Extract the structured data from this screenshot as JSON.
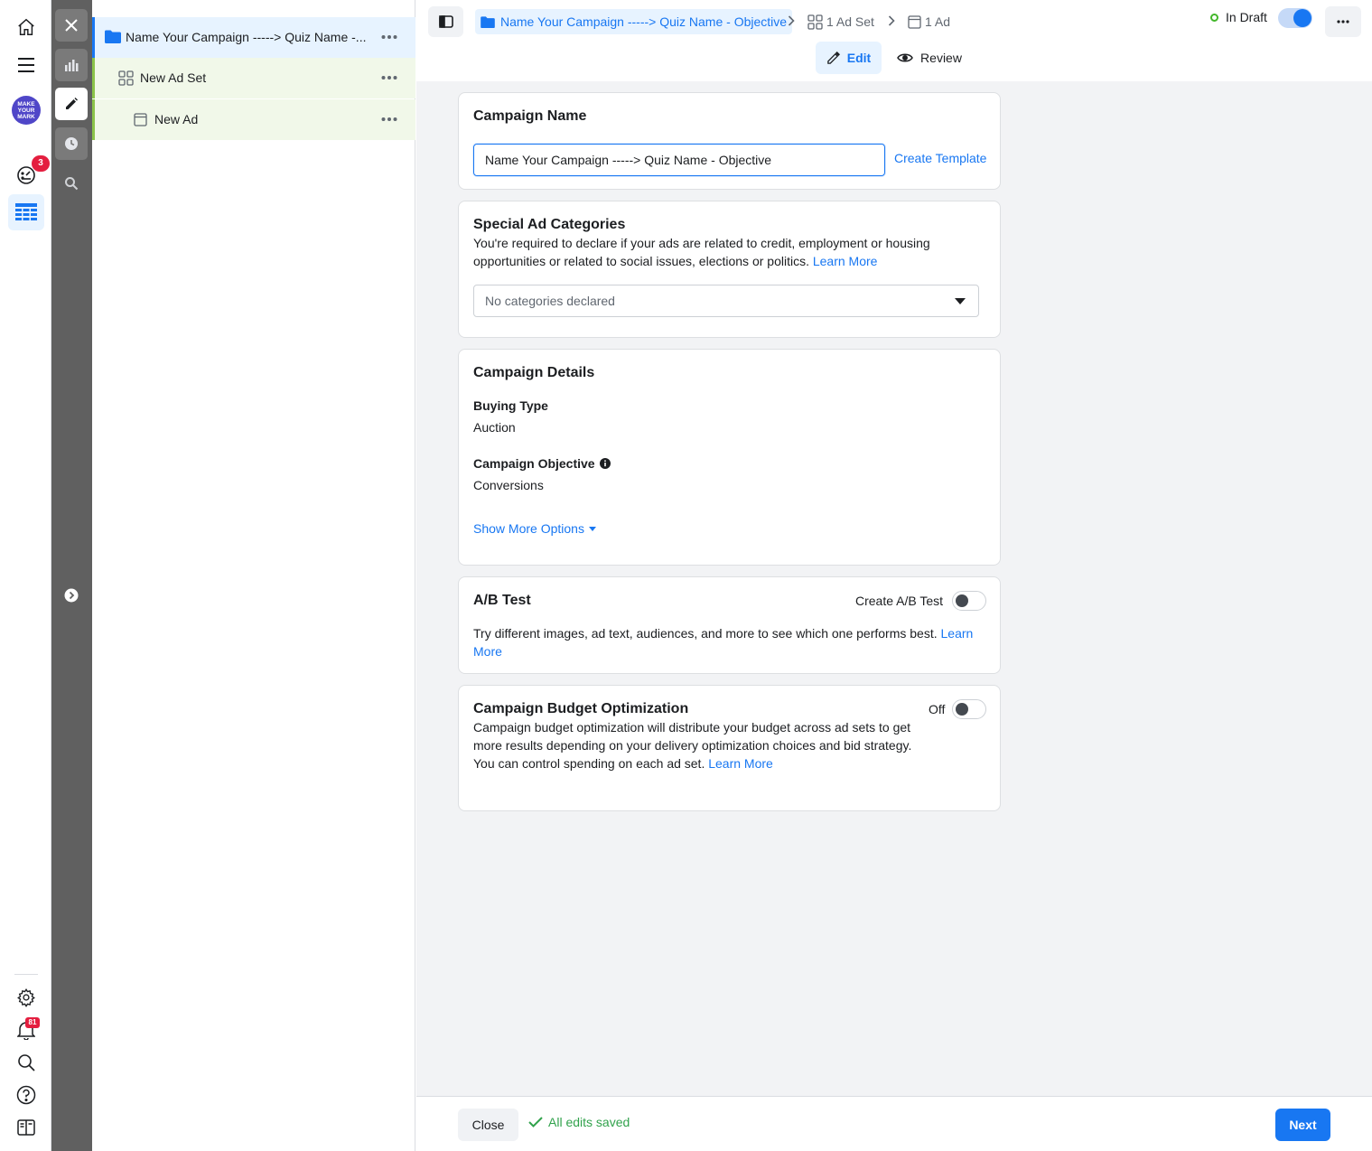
{
  "rail": {
    "avatar_line1": "MAKE",
    "avatar_line2": "YOUR",
    "avatar_line3": "MARK",
    "notifications_badge": "3",
    "alerts_badge": "81"
  },
  "tree": {
    "campaign_label": "Name Your Campaign -----> Quiz Name -...",
    "adset_label": "New Ad Set",
    "ad_label": "New Ad"
  },
  "topbar": {
    "breadcrumb_campaign": "Name Your Campaign -----> Quiz Name - Objective",
    "breadcrumb_adset": "1 Ad Set",
    "breadcrumb_ad": "1 Ad",
    "status": "In Draft",
    "tab_edit": "Edit",
    "tab_review": "Review"
  },
  "campaign_name": {
    "title": "Campaign Name",
    "value": "Name Your Campaign -----> Quiz Name - Objective",
    "create_template": "Create Template"
  },
  "special_ad": {
    "title": "Special Ad Categories",
    "description": "You're required to declare if your ads are related to credit, employment or housing opportunities or related to social issues, elections or politics.",
    "learn_more": "Learn More",
    "select_value": "No categories declared"
  },
  "details": {
    "title": "Campaign Details",
    "buying_type_label": "Buying Type",
    "buying_type_value": "Auction",
    "objective_label": "Campaign Objective",
    "objective_value": "Conversions",
    "show_more": "Show More Options"
  },
  "ab_test": {
    "title": "A/B Test",
    "toggle_label": "Create A/B Test",
    "description": "Try different images, ad text, audiences, and more to see which one performs best.",
    "learn_more": "Learn More"
  },
  "cbo": {
    "title": "Campaign Budget Optimization",
    "toggle_label": "Off",
    "description": "Campaign budget optimization will distribute your budget across ad sets to get more results depending on your delivery optimization choices and bid strategy. You can control spending on each ad set.",
    "learn_more": "Learn More"
  },
  "footer": {
    "close": "Close",
    "saved": "All edits saved",
    "next": "Next"
  },
  "colors": {
    "accent": "#1877f2",
    "success": "#31a24c",
    "badge": "#e41e3f"
  }
}
